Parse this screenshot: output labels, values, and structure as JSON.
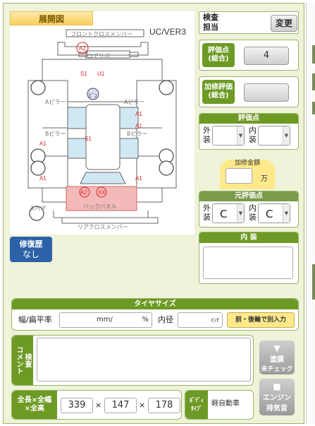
{
  "diagram": {
    "title": "展開図",
    "version": "UC/VER3",
    "parts": {
      "front_cross_member": "フロントクロスメンバー",
      "core_support": "コアサポ",
      "a_pillar": "Aピラー",
      "b_pillar": "Bピラー",
      "back_panel": "バックパネル",
      "rear_cross_member": "リアクロスメンバー",
      "spare": "スペア"
    },
    "marks": {
      "a2_front": "A2",
      "s1_top": "S1",
      "u1": "U1",
      "pin": "ﾋﾟﾝ",
      "a1_right_a": "A1",
      "a1_right_b": "A1",
      "a1_left": "A1",
      "s1_center": "S1",
      "a1_bottom_left": "A1",
      "a1_bottom_right": "A1",
      "a2_back": "A2",
      "xx_back": "XX"
    }
  },
  "repair": {
    "label1": "修復歴",
    "label2": "なし"
  },
  "inspector": {
    "label1": "検査",
    "label2": "担当",
    "change_button": "変更"
  },
  "overall_score": {
    "label1": "評価点",
    "label2": "(総合)",
    "value": "4"
  },
  "restore_score": {
    "label1": "加修評価",
    "label2": "(総合)",
    "value": ""
  },
  "score": {
    "title": "評価点",
    "ext1": "外",
    "ext2": "装",
    "int1": "内",
    "int2": "装",
    "ext_value": "",
    "int_value": ""
  },
  "repair_cost": {
    "label": "加修金額",
    "value": "",
    "unit": "万"
  },
  "orig_score": {
    "title": "元評価点",
    "ext1": "外",
    "ext2": "装",
    "int1": "内",
    "int2": "装",
    "ext_value": "C",
    "int_value": "C"
  },
  "interior": {
    "title": "内 装",
    "value": ""
  },
  "tire": {
    "title": "タイヤサイズ",
    "ratio_label": "幅/扁平率",
    "mm": "mm/",
    "pct": "%",
    "inner_label": "内径",
    "inch": "ｲﾝﾁ",
    "separate_button": "前・後輪で別入力"
  },
  "comment": {
    "l1": "検査",
    "l2": "コメント",
    "value": ""
  },
  "paint_button": {
    "l1": "塗膜",
    "l2": "未チェック"
  },
  "engine_button": {
    "l1": "エンジン",
    "l2": "排気音"
  },
  "dims": {
    "l1": "全長×全幅",
    "l2": "×全高",
    "length": "339",
    "width": "147",
    "height": "178",
    "x": "×"
  },
  "body_type": {
    "label1": "ﾎﾞﾃﾞｨ",
    "label2": "ﾀｲﾌﾟ",
    "value": "軽自動車"
  },
  "colors": {
    "accent": "#6d9a24",
    "panel": "#eef3d9",
    "blue_btn": "#2d62a8",
    "pink": "#f4b9b9",
    "lightblue": "#cfe8f3"
  }
}
